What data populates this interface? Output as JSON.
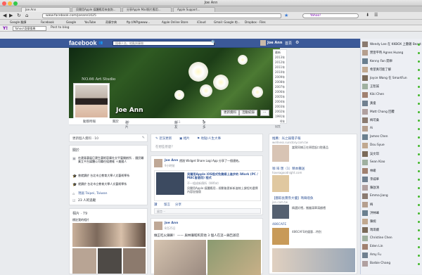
{
  "window": {
    "title": "Joe Ann"
  },
  "tabs": [
    {
      "label": "Joe Ann"
    },
    {
      "label": "貝爾用Apple 媒體應用來查詢..."
    },
    {
      "label": "分享Apple Mail照片應用..."
    },
    {
      "label": "Apple Support..."
    }
  ],
  "nav": {
    "url": "www.facebook.com/joeann1025",
    "search_placeholder": "Yahoo!"
  },
  "bookmarks": [
    "Google 翻譯",
    "Facebook",
    "Google",
    "YouTube",
    "奇摩字典",
    "ftp://WP@www...",
    "Apple Online Store",
    "iCloud",
    "Gmail: Google 的...",
    "Dropbox - Files",
    "..."
  ],
  "toolbar2": {
    "yahoo_search": "Yahoo!奇摩搜尋",
    "post": "Post to blog"
  },
  "facebook": {
    "logo": "facebook",
    "search_placeholder": "搜尋人名、地點與事物",
    "user_chip": "Joe Ann",
    "home": "首頁",
    "cover_text": "NO.66 Art Studio",
    "profile_name": "Joe Ann",
    "update_info": "更新資料",
    "activity_log": "活動紀錄",
    "tabs": [
      {
        "label": "動態時報"
      },
      {
        "label": "關於"
      },
      {
        "label": "相片",
        "count": "79"
      },
      {
        "label": "朋友",
        "count": "651"
      },
      {
        "label": "更多"
      }
    ],
    "years": [
      "最新",
      "2013年",
      "2012年",
      "2011年",
      "2010年",
      "2009年",
      "2008年",
      "2007年",
      "2006年",
      "2005年",
      "2004年",
      "2003年",
      "2002年",
      "1991年",
      "1990年",
      "出生"
    ],
    "left": {
      "recent": "更新個人資料 · 10",
      "about_title": "關於",
      "about_items": [
        "在建青藝展巨晟生藝術容庫社交平臺開創所 ．國民職業互平台媒體公司職任組運維 ＋美國人",
        "曾就讀於 台北市立教育大學人文藝術學系",
        "就讀於 台北市立教育大學人文藝術學系",
        "現居 Taipei, Taiwan",
        "23 人的追蹤"
      ],
      "photos_title": "相片 · 79",
      "album": "標註我的相片"
    },
    "composer": {
      "status": "近況更新",
      "photo": "相片",
      "place": "地點/人生大事",
      "placeholder": "在想些甚麼？"
    },
    "posts": [
      {
        "author": "Joe Ann",
        "action": "透過 Widget Share Logi App 分享了一個連結。",
        "time": "9小時前",
        "link_title": "貝爾用Apple iOS程式免費線上進步的 iWork (PC / MAC皆適用) 程式",
        "link_source": "不一組成新傳所（Wiflat）",
        "link_desc": "貝爾用Apple 媒體應用…規劃後更新新進線上課程的選擇內容加強版",
        "actions": [
          "讚",
          "留言",
          "分享"
        ],
        "comment_ph": "留言⋯"
      },
      {
        "author": "Joe Ann",
        "time": "8月25日",
        "text": "做正吃火鍋嘛！ —— 與林珊瑤和其他 3 個人在這一鍋告辦店"
      }
    ],
    "right_col": [
      {
        "title": "推薦：光之鑰電子報",
        "sub": "wellness.sunstory.com.tw",
        "desc": "當實同樣正在原提起口腔產品"
      },
      {
        "title": "咖 啡 匯（1）精本攤送",
        "sub": "haveagoodnight.com",
        "desc": ""
      },
      {
        "title": "【圖取長實券大優】瑪韓燈魚",
        "sub": "jon.com.tw",
        "desc": "精選好禮，攜繼滿單滿額禮"
      },
      {
        "title": "486CAFE",
        "sub": "",
        "desc": "486CAFE的優惠…特別"
      }
    ]
  },
  "chat": {
    "contacts": [
      {
        "name": "Wendy Lee 在 KKBOX 上聽著 Beast"
      },
      {
        "name": "實習平時 Agnes Huang"
      },
      {
        "name": "Kenny Fan 開車"
      },
      {
        "name": "希望真可能了解"
      },
      {
        "name": "Joyce Wang 在 SmartFun"
      },
      {
        "name": "王智誠"
      },
      {
        "name": "Kiki Chen"
      },
      {
        "name": "黃俊"
      },
      {
        "name": "Matt Chang 回覆"
      },
      {
        "name": "梅可桑"
      },
      {
        "name": "Ai"
      },
      {
        "name": "James Chen"
      },
      {
        "name": "Dou Syue"
      },
      {
        "name": "吳文琪"
      },
      {
        "name": "Sean Kiao"
      },
      {
        "name": "林峻"
      },
      {
        "name": "李威華"
      },
      {
        "name": "陳啟鴻"
      },
      {
        "name": "Emma Jiang"
      },
      {
        "name": "梅"
      },
      {
        "name": "洪林峰"
      },
      {
        "name": "陳婉"
      },
      {
        "name": "瑪琪嫺"
      },
      {
        "name": "Christine Chen"
      },
      {
        "name": "Eden Lin"
      },
      {
        "name": "Amy Fu"
      },
      {
        "name": "Barbie Chang"
      }
    ]
  },
  "colors": {
    "fb_blue": "#3b5998",
    "online": "#42b72a"
  }
}
